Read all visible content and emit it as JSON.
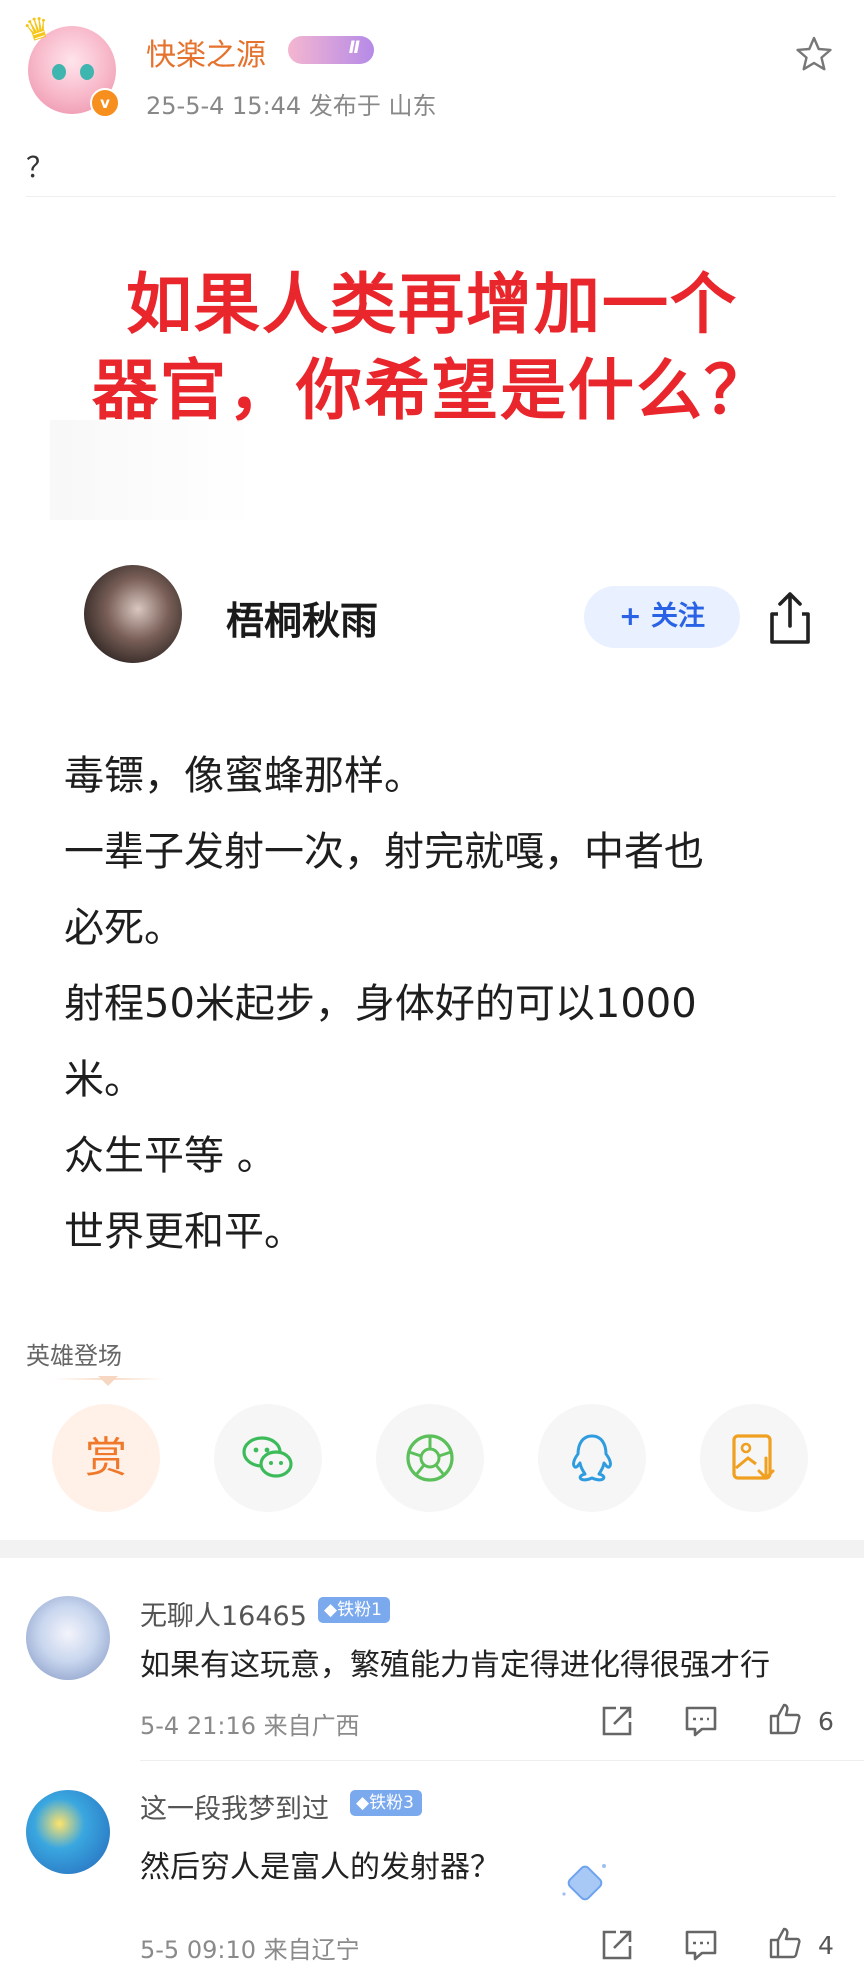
{
  "post": {
    "author": "快楽之源",
    "level_badge": "Ⅱ",
    "verified_mark": "v",
    "meta": "25-5-4 15:44  发布于 山东",
    "text": "？"
  },
  "image": {
    "headline_line1": "如果人类再增加一个",
    "headline_line2": "器官，你希望是什么？",
    "inner_author": "梧桐秋雨",
    "follow_label": "+ 关注",
    "answer": [
      "毒镖，像蜜蜂那样。",
      "一辈子发射一次，射完就嘎，中者也",
      "必死。",
      "射程50米起步，身体好的可以1000",
      "米。",
      "众生平等 。",
      "世界更和平。"
    ]
  },
  "reward": {
    "label": "英雄登场",
    "button": "赏"
  },
  "comments": [
    {
      "name": "无聊人16465",
      "badge": "◆铁粉1",
      "text": "如果有这玩意，繁殖能力肯定得进化得很强才行",
      "meta": "5-4 21:16  来自广西",
      "likes": "6"
    },
    {
      "name": "这一段我梦到过",
      "badge": "◆铁粉3",
      "text": "然后穷人是富人的发射器？",
      "meta": "5-5 09:10  来自辽宁",
      "likes": "4"
    }
  ],
  "colors": {
    "author_orange": "#e5732d",
    "headline_red": "#e8262c",
    "follow_blue": "#2a62e6",
    "fan_badge_blue": "#7aa9ee"
  },
  "icons": [
    "star-icon",
    "share-icon",
    "wechat-icon",
    "moments-icon",
    "qq-icon",
    "save-image-icon",
    "repost-icon",
    "comment-icon",
    "like-icon"
  ]
}
